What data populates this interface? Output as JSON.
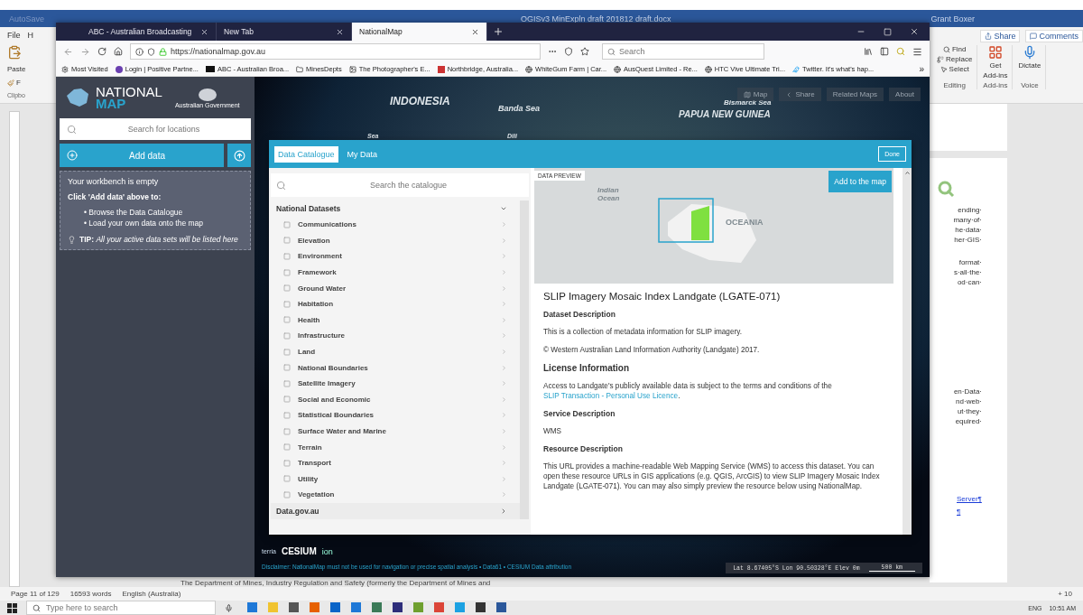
{
  "word": {
    "autosave": "AutoSave",
    "title": "OGISv3 MinExpln draft 201812 draft.docx",
    "user": "Grant Boxer",
    "left_ribbon": {
      "file_tab": "File",
      "home_tab": "H",
      "paste": "Paste",
      "format_painter": "F",
      "clipboard_group": "Clipbo"
    },
    "right_ribbon": {
      "share": "Share",
      "comments": "Comments",
      "find": "Find",
      "replace": "Replace",
      "select": "Select",
      "editing_group": "Editing",
      "get": "Get",
      "addins": "Add-ins",
      "addins_group": "Add-ins",
      "dictate": "Dictate",
      "voice_group": "Voice"
    },
    "paragraphs": [
      [
        "ending·",
        "many·of·",
        "he·data·",
        "her·GIS·"
      ],
      [
        "format·",
        "s·all·the·",
        "od·can·"
      ],
      [
        "en·Data·",
        "nd·web·",
        "ut·they·",
        "equired·"
      ]
    ],
    "links": [
      "Server¶",
      "¶"
    ],
    "bottom_line": "The Department of Mines, Industry Regulation and Safety (formerly the Department of Mines and",
    "status": {
      "page": "Page 11 of 129",
      "words": "16593 words",
      "language": "English (Australia)",
      "zoom": "+ 10"
    }
  },
  "browser": {
    "tabs": [
      {
        "label": "ABC - Australian Broadcasting",
        "selected": false
      },
      {
        "label": "New Tab",
        "selected": false
      },
      {
        "label": "NationalMap",
        "selected": true
      }
    ],
    "url": "https://nationalmap.gov.au",
    "search_placeholder": "Search",
    "bookmarks": [
      {
        "kind": "gear",
        "label": "Most Visited"
      },
      {
        "kind": "circle",
        "label": "Login | Positive Partne..."
      },
      {
        "kind": "abc",
        "label": "ABC - Australian Broa..."
      },
      {
        "kind": "folder",
        "label": "MinesDepts"
      },
      {
        "kind": "photo",
        "label": "The Photographer's E..."
      },
      {
        "kind": "square",
        "label": "Northbridge, Australia..."
      },
      {
        "kind": "globe",
        "label": "WhiteGum Farm | Car..."
      },
      {
        "kind": "globe",
        "label": "AusQuest Limited - Re..."
      },
      {
        "kind": "globe",
        "label": "HTC Vive Ultimate Tri..."
      },
      {
        "kind": "bird",
        "label": "Twitter. It's what's hap..."
      }
    ],
    "overflow": "»"
  },
  "app": {
    "logo": {
      "line1": "NATIONAL",
      "line2": "MAP",
      "gov": "Australian Government"
    },
    "location_search_placeholder": "Search for locations",
    "add_data": "Add data",
    "workbench": {
      "empty": "Your workbench is empty",
      "prompt": "Click 'Add data' above to:",
      "bullet": "•",
      "bullets": [
        "Browse the Data Catalogue",
        "Load your own data onto the map"
      ],
      "tip_label": "TIP:",
      "tip": "All your active data sets will be listed here"
    },
    "map_labels": [
      "INDONESIA",
      "Banda Sea",
      "Bismarck Sea",
      "PAPUA NEW GUINEA",
      "Dili",
      "Sea"
    ],
    "map_buttons": [
      "Map",
      "Share",
      "Related Maps",
      "About"
    ],
    "modal": {
      "tabs": [
        {
          "label": "Data Catalogue",
          "selected": true
        },
        {
          "label": "My Data",
          "selected": false
        }
      ],
      "done": "Done",
      "search_placeholder": "Search the catalogue",
      "groups": [
        {
          "label": "National Datasets",
          "expanded": true,
          "children": [
            {
              "label": "Communications"
            },
            {
              "label": "Elevation"
            },
            {
              "label": "Environment"
            },
            {
              "label": "Framework"
            },
            {
              "label": "Ground Water"
            },
            {
              "label": "Habitation"
            },
            {
              "label": "Health"
            },
            {
              "label": "Infrastructure"
            },
            {
              "label": "Land"
            },
            {
              "label": "National Boundaries"
            },
            {
              "label": "Satellite Imagery"
            },
            {
              "label": "Social and Economic"
            },
            {
              "label": "Statistical Boundaries"
            },
            {
              "label": "Surface Water and Marine"
            },
            {
              "label": "Terrain"
            },
            {
              "label": "Transport"
            },
            {
              "label": "Utility"
            },
            {
              "label": "Vegetation"
            }
          ]
        },
        {
          "label": "Data.gov.au",
          "expanded": false
        }
      ],
      "preview": {
        "badge": "DATA PREVIEW",
        "add_button": "Add to the map",
        "map_labels": [
          "Indian Ocean",
          "OCEANIA"
        ],
        "title": "SLIP Imagery Mosaic Index Landgate (LGATE-071)",
        "sections": [
          {
            "kind": "subheading",
            "text": "Dataset Description"
          },
          {
            "kind": "paragraph",
            "text": "This is a collection of metadata information for SLIP imagery."
          },
          {
            "kind": "paragraph",
            "text": "© Western Australian Land Information Authority (Landgate) 2017."
          },
          {
            "kind": "heading",
            "text": "License Information"
          },
          {
            "kind": "paragraph",
            "text": "Access to Landgate's publicly available data is subject to the terms and conditions of the",
            "link": "SLIP Transaction - Personal Use Licence",
            "after": "."
          },
          {
            "kind": "subheading",
            "text": "Service Description"
          },
          {
            "kind": "paragraph",
            "text": "WMS"
          },
          {
            "kind": "subheading",
            "text": "Resource Description"
          },
          {
            "kind": "paragraph",
            "text": "This URL provides a machine-readable Web Mapping Service (WMS) to access this dataset. You can open these resource URLs in GIS applications (e.g. QGIS, ArcGIS) to view SLIP Imagery Mosaic Index Landgate (LGATE-071). You can may also simply preview the resource below using NationalMap."
          }
        ]
      }
    },
    "footer": {
      "terria": "terria",
      "cesium": "CESIUM",
      "ion": "ion",
      "disclaimer": "Disclaimer: NationalMap must not be used for navigation or precise spatial analysis • Data61 • CESIUM Data attribution",
      "coords": "Lat 8.67405°S  Lon 90.50328°E  Elev 0m",
      "scale": "500 km"
    }
  },
  "taskbar": {
    "search_placeholder": "Type here to search",
    "language": "ENG",
    "time": "10:51 AM"
  }
}
